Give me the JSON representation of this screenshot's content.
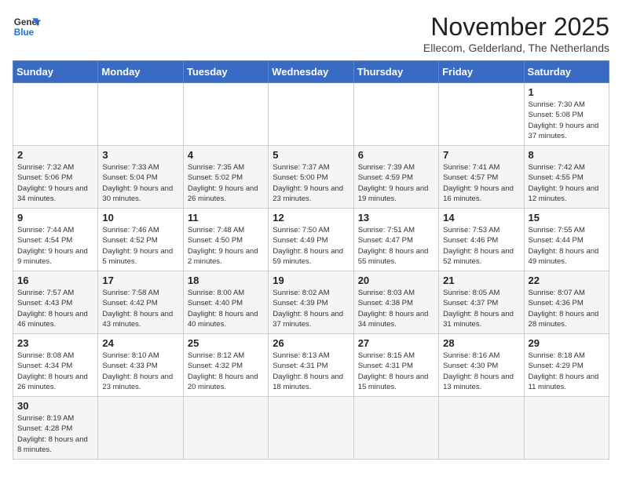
{
  "logo": {
    "line1": "General",
    "line2": "Blue"
  },
  "title": "November 2025",
  "location": "Ellecom, Gelderland, The Netherlands",
  "weekdays": [
    "Sunday",
    "Monday",
    "Tuesday",
    "Wednesday",
    "Thursday",
    "Friday",
    "Saturday"
  ],
  "days": {
    "1": {
      "sunrise": "7:30 AM",
      "sunset": "5:08 PM",
      "daylight": "9 hours and 37 minutes."
    },
    "2": {
      "sunrise": "7:32 AM",
      "sunset": "5:06 PM",
      "daylight": "9 hours and 34 minutes."
    },
    "3": {
      "sunrise": "7:33 AM",
      "sunset": "5:04 PM",
      "daylight": "9 hours and 30 minutes."
    },
    "4": {
      "sunrise": "7:35 AM",
      "sunset": "5:02 PM",
      "daylight": "9 hours and 26 minutes."
    },
    "5": {
      "sunrise": "7:37 AM",
      "sunset": "5:00 PM",
      "daylight": "9 hours and 23 minutes."
    },
    "6": {
      "sunrise": "7:39 AM",
      "sunset": "4:59 PM",
      "daylight": "9 hours and 19 minutes."
    },
    "7": {
      "sunrise": "7:41 AM",
      "sunset": "4:57 PM",
      "daylight": "9 hours and 16 minutes."
    },
    "8": {
      "sunrise": "7:42 AM",
      "sunset": "4:55 PM",
      "daylight": "9 hours and 12 minutes."
    },
    "9": {
      "sunrise": "7:44 AM",
      "sunset": "4:54 PM",
      "daylight": "9 hours and 9 minutes."
    },
    "10": {
      "sunrise": "7:46 AM",
      "sunset": "4:52 PM",
      "daylight": "9 hours and 5 minutes."
    },
    "11": {
      "sunrise": "7:48 AM",
      "sunset": "4:50 PM",
      "daylight": "9 hours and 2 minutes."
    },
    "12": {
      "sunrise": "7:50 AM",
      "sunset": "4:49 PM",
      "daylight": "8 hours and 59 minutes."
    },
    "13": {
      "sunrise": "7:51 AM",
      "sunset": "4:47 PM",
      "daylight": "8 hours and 55 minutes."
    },
    "14": {
      "sunrise": "7:53 AM",
      "sunset": "4:46 PM",
      "daylight": "8 hours and 52 minutes."
    },
    "15": {
      "sunrise": "7:55 AM",
      "sunset": "4:44 PM",
      "daylight": "8 hours and 49 minutes."
    },
    "16": {
      "sunrise": "7:57 AM",
      "sunset": "4:43 PM",
      "daylight": "8 hours and 46 minutes."
    },
    "17": {
      "sunrise": "7:58 AM",
      "sunset": "4:42 PM",
      "daylight": "8 hours and 43 minutes."
    },
    "18": {
      "sunrise": "8:00 AM",
      "sunset": "4:40 PM",
      "daylight": "8 hours and 40 minutes."
    },
    "19": {
      "sunrise": "8:02 AM",
      "sunset": "4:39 PM",
      "daylight": "8 hours and 37 minutes."
    },
    "20": {
      "sunrise": "8:03 AM",
      "sunset": "4:38 PM",
      "daylight": "8 hours and 34 minutes."
    },
    "21": {
      "sunrise": "8:05 AM",
      "sunset": "4:37 PM",
      "daylight": "8 hours and 31 minutes."
    },
    "22": {
      "sunrise": "8:07 AM",
      "sunset": "4:36 PM",
      "daylight": "8 hours and 28 minutes."
    },
    "23": {
      "sunrise": "8:08 AM",
      "sunset": "4:34 PM",
      "daylight": "8 hours and 26 minutes."
    },
    "24": {
      "sunrise": "8:10 AM",
      "sunset": "4:33 PM",
      "daylight": "8 hours and 23 minutes."
    },
    "25": {
      "sunrise": "8:12 AM",
      "sunset": "4:32 PM",
      "daylight": "8 hours and 20 minutes."
    },
    "26": {
      "sunrise": "8:13 AM",
      "sunset": "4:31 PM",
      "daylight": "8 hours and 18 minutes."
    },
    "27": {
      "sunrise": "8:15 AM",
      "sunset": "4:31 PM",
      "daylight": "8 hours and 15 minutes."
    },
    "28": {
      "sunrise": "8:16 AM",
      "sunset": "4:30 PM",
      "daylight": "8 hours and 13 minutes."
    },
    "29": {
      "sunrise": "8:18 AM",
      "sunset": "4:29 PM",
      "daylight": "8 hours and 11 minutes."
    },
    "30": {
      "sunrise": "8:19 AM",
      "sunset": "4:28 PM",
      "daylight": "8 hours and 8 minutes."
    }
  }
}
